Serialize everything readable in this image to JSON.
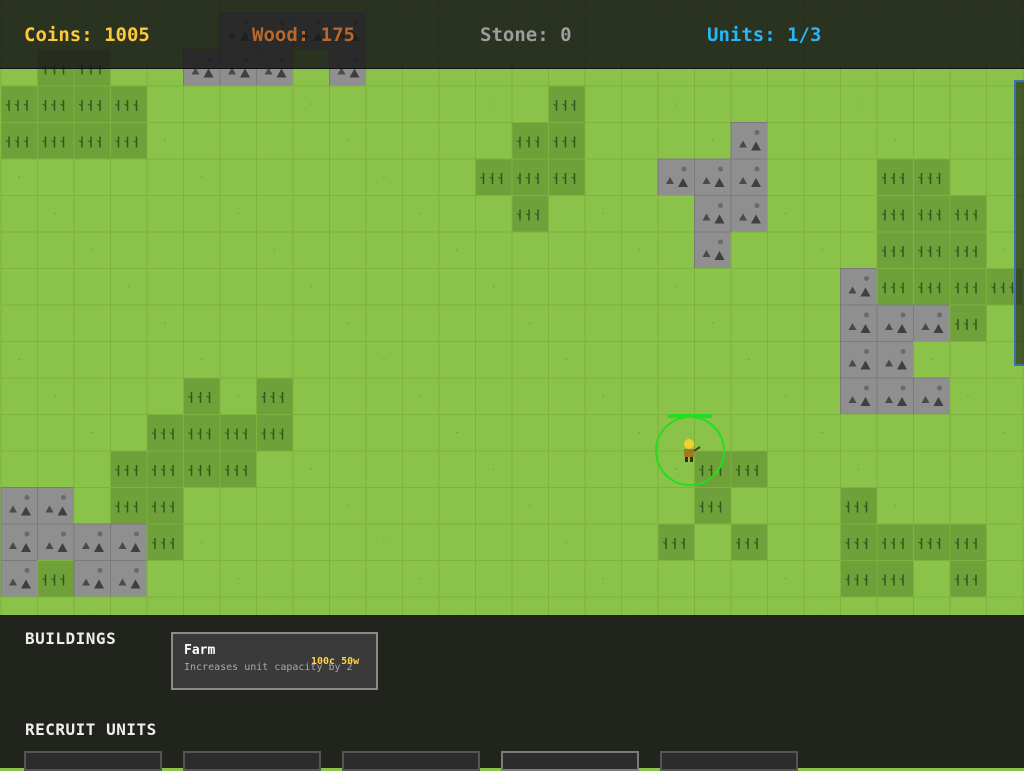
{
  "resources": {
    "coins": {
      "label": "Coins: 1005",
      "color": "#ffc93c"
    },
    "wood": {
      "label": "Wood: 175",
      "color": "#b8682c"
    },
    "stone": {
      "label": "Stone: 0",
      "color": "#9e9e9e"
    },
    "units": {
      "label": "Units: 1/3",
      "color": "#29b6f6"
    }
  },
  "palette": {
    "grass": "#8bc34a",
    "grid": "#7db23f",
    "forest": "#6fa03a",
    "rock": "#8f8f8f",
    "selection": "#22dd22"
  },
  "player_unit": {
    "icon": "worker-unit-icon",
    "selected": true,
    "health_fraction": 1.0
  },
  "panel": {
    "buildings_title": "BUILDINGS",
    "recruit_title": "RECRUIT UNITS",
    "buildings": [
      {
        "name": "Farm",
        "description": "Increases unit capacity by 2",
        "cost": "100c 50w"
      }
    ],
    "recruit_slots": 5
  }
}
